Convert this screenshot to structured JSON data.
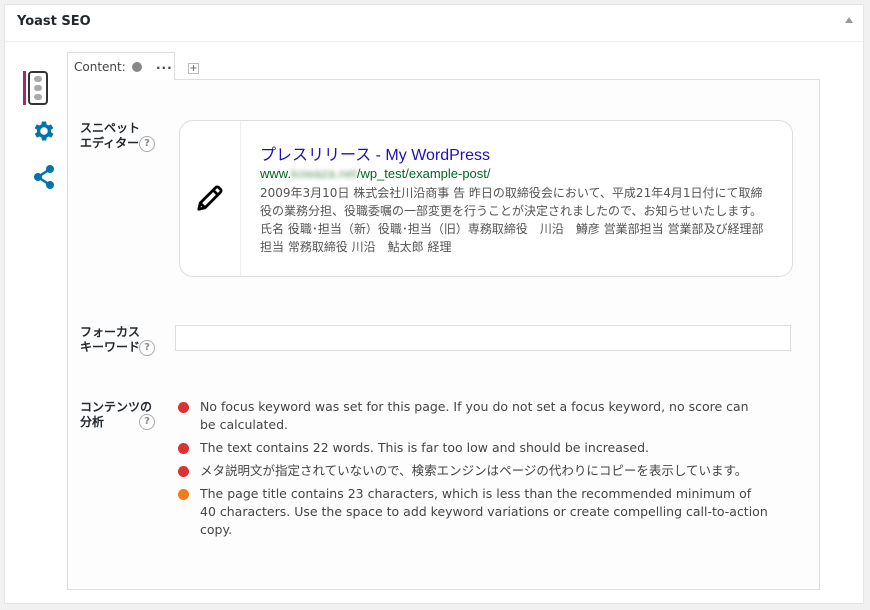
{
  "metabox": {
    "title": "Yoast SEO"
  },
  "colors": {
    "red": "#dc3232",
    "orange": "#ee7c1b",
    "link": "#1e0fbe",
    "url": "#006621",
    "accent": "#0073aa"
  },
  "sidebar": {
    "items": [
      {
        "icon": "traffic-light-icon",
        "active": true
      },
      {
        "icon": "gear-icon"
      },
      {
        "icon": "share-icon"
      }
    ]
  },
  "tabs": {
    "content_label": "Content:",
    "more": "...",
    "add": "+"
  },
  "snippet_editor": {
    "label": "スニペットエディター",
    "title": "プレスリリース - My WordPress",
    "url_prefix": "www.",
    "url_domain": "kowaza.net",
    "url_path": "/wp_test/example-post/",
    "description": "2009年3月10日 株式会社川沿商事 告 昨日の取締役会において、平成21年4月1日付にて取締役の業務分担、役職委嘱の一部変更を行うことが決定されましたので、お知らせいたします。氏名 役職･担当（新）役職･担当（旧）専務取締役　川沿　鱒彦 営業部担当 営業部及び経理部担当 常務取締役 川沿　鮎太郎 経理"
  },
  "focus_keyword": {
    "label": "フォーカスキーワード",
    "value": ""
  },
  "content_analysis": {
    "label": "コンテンツの分析",
    "items": [
      {
        "status": "red",
        "text": "No focus keyword was set for this page. If you do not set a focus keyword, no score can be calculated."
      },
      {
        "status": "red",
        "text": "The text contains 22 words. This is far too low and should be increased."
      },
      {
        "status": "red",
        "text": "メタ説明文が指定されていないので、検索エンジンはページの代わりにコピーを表示しています。"
      },
      {
        "status": "orange",
        "text": "The page title contains 23 characters, which is less than the recommended minimum of 40 characters. Use the space to add keyword variations or create compelling call-to-action copy."
      }
    ]
  }
}
